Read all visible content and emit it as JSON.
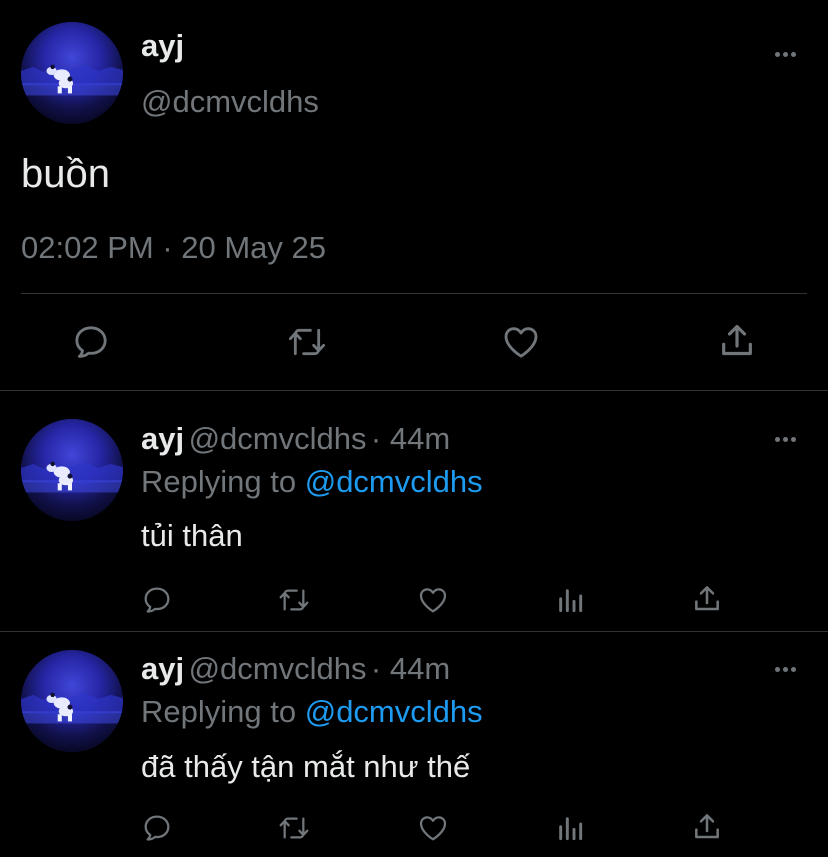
{
  "colors": {
    "background": "#000000",
    "text": "#e7e9ea",
    "muted": "#71767b",
    "link": "#1d9bf0",
    "divider": "#2f3336"
  },
  "main_tweet": {
    "name": "ayj",
    "handle": "@dcmvcldhs",
    "text": "buồn",
    "meta": "02:02 PM · 20 May 25",
    "actions": [
      "reply-icon",
      "retweet-icon",
      "like-icon",
      "share-icon"
    ]
  },
  "replies": [
    {
      "name": "ayj",
      "handle": "@dcmvcldhs",
      "time": "· 44m",
      "replying_prefix": "Replying to",
      "replying_to": "@dcmvcldhs",
      "text": "tủi thân",
      "actions": [
        "reply-icon",
        "retweet-icon",
        "like-icon",
        "analytics-icon",
        "share-icon"
      ]
    },
    {
      "name": "ayj",
      "handle": "@dcmvcldhs",
      "time": "· 44m",
      "replying_prefix": "Replying to",
      "replying_to": "@dcmvcldhs",
      "text": "đã thấy tận mắt như thế",
      "actions": [
        "reply-icon",
        "retweet-icon",
        "like-icon",
        "analytics-icon",
        "share-icon"
      ]
    }
  ]
}
